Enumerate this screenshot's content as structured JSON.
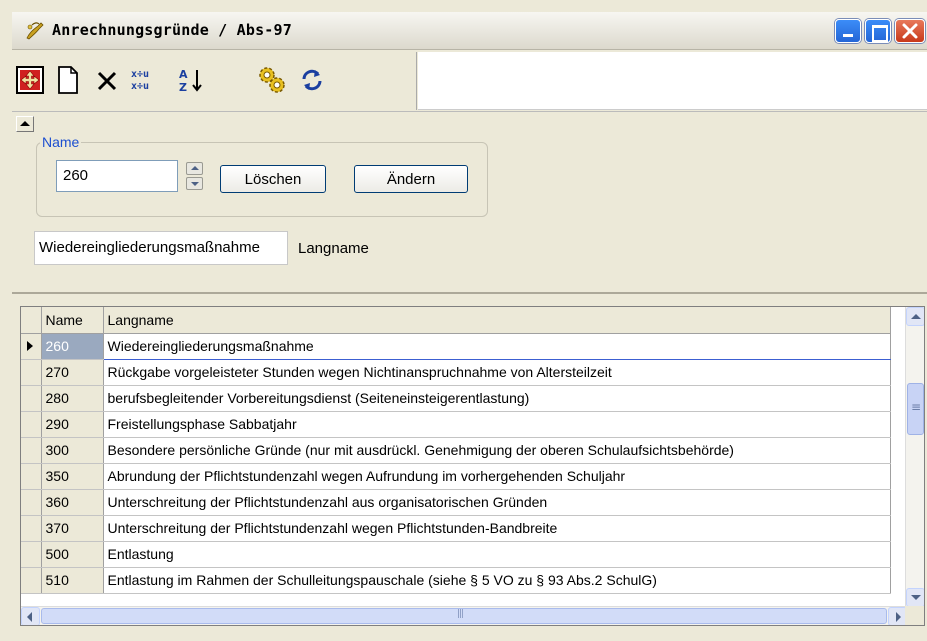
{
  "window": {
    "title": "Anrechnungsgründe / Abs-97"
  },
  "toolbar": {
    "tools": [
      "move-icon",
      "new-document-icon",
      "delete-icon",
      "transfer-icon",
      "sort-icon",
      "gear-icon",
      "refresh-icon"
    ]
  },
  "form": {
    "group_label": "Name",
    "name_value": "260",
    "delete_label": "Löschen",
    "change_label": "Ändern",
    "longname_value": "Wiedereingliederungsmaßnahme",
    "longname_label": "Langname"
  },
  "grid": {
    "columns": [
      "Name",
      "Langname"
    ],
    "rows": [
      {
        "name": "260",
        "longname": "Wiedereingliederungsmaßnahme"
      },
      {
        "name": "270",
        "longname": "Rückgabe vorgeleisteter Stunden wegen Nichtinanspruchnahme von Altersteilzeit"
      },
      {
        "name": "280",
        "longname": "berufsbegleitender Vorbereitungsdienst (Seiteneinsteigerentlastung)"
      },
      {
        "name": "290",
        "longname": "Freistellungsphase Sabbatjahr"
      },
      {
        "name": "300",
        "longname": "Besondere persönliche Gründe (nur mit ausdrückl. Genehmigung der oberen Schulaufsichtsbehörde)"
      },
      {
        "name": "350",
        "longname": "Abrundung der Pflichtstundenzahl wegen Aufrundung im vorhergehenden Schuljahr"
      },
      {
        "name": "360",
        "longname": "Unterschreitung der Pflichtstundenzahl aus organisatorischen Gründen"
      },
      {
        "name": "370",
        "longname": "Unterschreitung der Pflichtstundenzahl wegen Pflichtstunden-Bandbreite"
      },
      {
        "name": "500",
        "longname": "Entlastung"
      },
      {
        "name": "510",
        "longname": "Entlastung im Rahmen der Schulleitungspauschale (siehe § 5 VO zu § 93 Abs.2 SchulG)"
      }
    ]
  }
}
